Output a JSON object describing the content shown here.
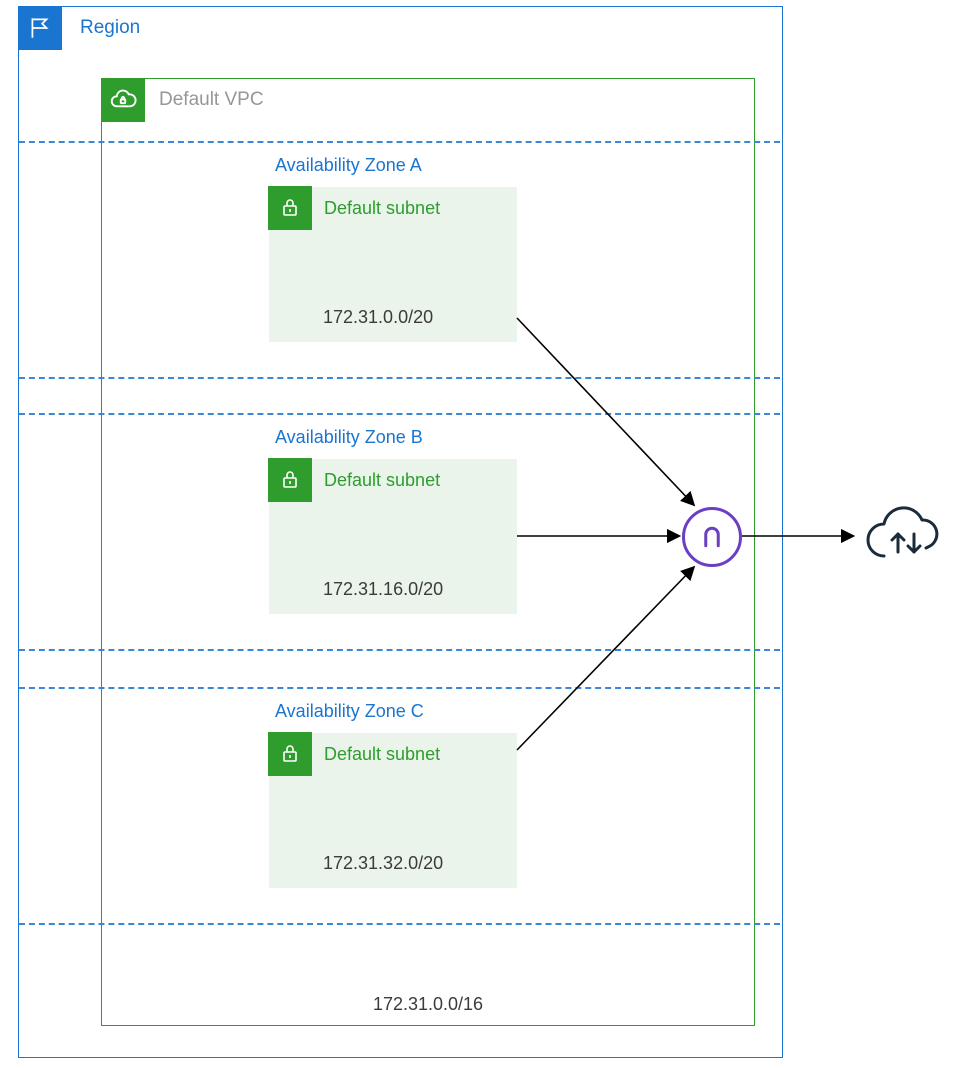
{
  "region": {
    "title": "Region"
  },
  "vpc": {
    "title": "Default VPC",
    "cidr": "172.31.0.0/16"
  },
  "azs": [
    {
      "title": "Availability Zone A",
      "subnet_label": "Default subnet",
      "cidr": "172.31.0.0/20"
    },
    {
      "title": "Availability Zone B",
      "subnet_label": "Default subnet",
      "cidr": "172.31.16.0/20"
    },
    {
      "title": "Availability Zone C",
      "subnet_label": "Default subnet",
      "cidr": "172.31.32.0/20"
    }
  ]
}
